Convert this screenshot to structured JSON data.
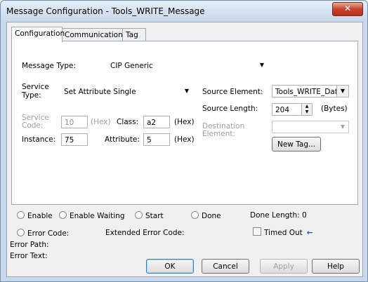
{
  "window": {
    "title": "Message Configuration - Tools_WRITE_Message",
    "close_glyph": "✕"
  },
  "tabs": [
    "Configuration",
    "Communication",
    "Tag"
  ],
  "config": {
    "message_type_label": "Message Type:",
    "message_type_value": "CIP Generic",
    "service_type_label_1": "Service",
    "service_type_label_2": "Type:",
    "service_type_value": "Set Attribute Single",
    "service_code_label_1": "Service",
    "service_code_label_2": "Code:",
    "service_code_value": "10",
    "hex_label": "(Hex)",
    "class_label": "Class:",
    "class_value": "a2",
    "instance_label": "Instance:",
    "instance_value": "75",
    "attribute_label": "Attribute:",
    "attribute_value": "5",
    "source_element_label": "Source Element:",
    "source_element_value": "Tools_WRITE_Data",
    "source_length_label": "Source Length:",
    "source_length_value": "204",
    "bytes_label": "(Bytes)",
    "destination_label_1": "Destination",
    "destination_label_2": "Element:",
    "destination_value": "",
    "new_tag_label": "New Tag..."
  },
  "status": {
    "enable": "Enable",
    "enable_waiting": "Enable Waiting",
    "start": "Start",
    "done": "Done",
    "done_length": "Done Length: 0",
    "error_code": "Error Code:",
    "extended_error_code": "Extended Error Code:",
    "timed_out": "Timed Out",
    "error_path": "Error Path:",
    "error_text": "Error Text:"
  },
  "buttons": {
    "ok": "OK",
    "cancel": "Cancel",
    "apply": "Apply",
    "help": "Help"
  },
  "colors": {
    "timed_out_arrow": "#1d4fd6"
  }
}
